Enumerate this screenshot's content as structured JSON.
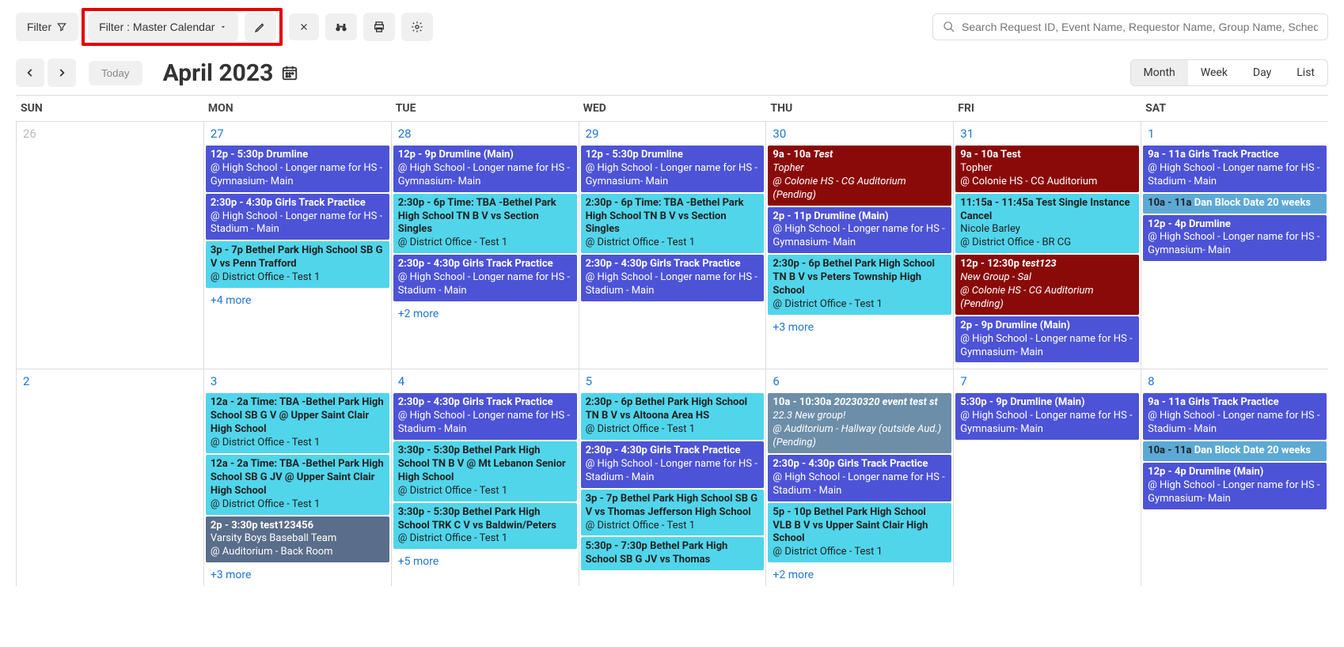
{
  "toolbar": {
    "filter_label": "Filter",
    "filter_master": "Filter : Master Calendar",
    "search_placeholder": "Search Request ID, Event Name, Requestor Name, Group Name, Schedule ID"
  },
  "header": {
    "today_label": "Today",
    "title": "April 2023",
    "views": [
      "Month",
      "Week",
      "Day",
      "List"
    ],
    "active_view": "Month"
  },
  "dayheaders": [
    "SUN",
    "MON",
    "TUE",
    "WED",
    "THU",
    "FRI",
    "SAT"
  ],
  "weeks": [
    {
      "days": [
        {
          "num": "26",
          "muted": true,
          "events": []
        },
        {
          "num": "27",
          "events": [
            {
              "cls": "indigo",
              "t": "12p - 5:30p Drumline",
              "d": "@ High School - Longer name for HS - Gymnasium- Main"
            },
            {
              "cls": "indigo",
              "t": "2:30p - 4:30p Girls Track Practice",
              "d": "@ High School - Longer name for HS - Stadium - Main"
            },
            {
              "cls": "cyan",
              "t": "3p - 7p Bethel Park High School SB G V vs Penn Trafford",
              "d": "@ District Office - Test 1"
            }
          ],
          "more": "+4 more"
        },
        {
          "num": "28",
          "events": [
            {
              "cls": "indigo",
              "t": "12p - 9p Drumline (Main)",
              "d": "@ High School - Longer name for HS - Gymnasium- Main"
            },
            {
              "cls": "cyan",
              "t": "2:30p - 6p Time: TBA -Bethel Park High School TN B V vs Section Singles",
              "d": "@ District Office - Test 1"
            },
            {
              "cls": "indigo",
              "t": "2:30p - 4:30p Girls Track Practice",
              "d": "@ High School - Longer name for HS - Stadium - Main"
            }
          ],
          "more": "+2 more"
        },
        {
          "num": "29",
          "events": [
            {
              "cls": "indigo",
              "t": "12p - 5:30p Drumline",
              "d": "@ High School - Longer name for HS - Gymnasium- Main"
            },
            {
              "cls": "cyan",
              "t": "2:30p - 6p Time: TBA -Bethel Park High School TN B V vs Section Singles",
              "d": "@ District Office - Test 1"
            },
            {
              "cls": "indigo",
              "t": "2:30p - 4:30p Girls Track Practice",
              "d": "@ High School - Longer name for HS - Stadium - Main"
            }
          ]
        },
        {
          "num": "30",
          "events": [
            {
              "cls": "maroon",
              "t": "9a - 10a <i>Test</i>",
              "d": "<i>Topher<br>@ Colonie HS - CG Auditorium (Pending)</i>"
            },
            {
              "cls": "indigo",
              "t": "2p - 11p Drumline (Main)",
              "d": "@ High School - Longer name for HS - Gymnasium- Main"
            },
            {
              "cls": "cyan",
              "t": "2:30p - 6p Bethel Park High School TN B V vs Peters Township High School",
              "d": "@ District Office - Test 1"
            }
          ],
          "more": "+3 more"
        },
        {
          "num": "31",
          "events": [
            {
              "cls": "maroon",
              "t": "9a - 10a Test",
              "d": "Topher<br>@ Colonie HS - CG Auditorium"
            },
            {
              "cls": "cyan",
              "t": "11:15a - 11:45a Test Single Instance Cancel",
              "d": "Nicole Barley<br>@ District Office - BR CG"
            },
            {
              "cls": "maroon",
              "t": "12p - 12:30p <i>test123</i>",
              "d": "<i>New Group - Sal<br>@ Colonie HS - CG Auditorium (Pending)</i>"
            },
            {
              "cls": "indigo",
              "t": "2p - 9p Drumline (Main)",
              "d": "@ High School - Longer name for HS - Gymnasium- Main"
            }
          ]
        },
        {
          "num": "1",
          "events": [
            {
              "cls": "indigo",
              "t": "9a - 11a Girls Track Practice",
              "d": "@ High School - Longer name for HS - Stadium - Main"
            },
            {
              "cls": "lightblue",
              "t": "10a - 11a <span style='color:#fff'>Dan Block Date 20 weeks</span>",
              "d": ""
            },
            {
              "cls": "indigo",
              "t": "12p - 4p Drumline",
              "d": "@ High School - Longer name for HS - Gymnasium- Main"
            }
          ]
        }
      ]
    },
    {
      "days": [
        {
          "num": "2",
          "events": []
        },
        {
          "num": "3",
          "events": [
            {
              "cls": "cyan",
              "t": "12a - 2a Time: TBA -Bethel Park High School SB G V @ Upper Saint Clair High School",
              "d": "@ District Office - Test 1"
            },
            {
              "cls": "cyan",
              "t": "12a - 2a Time: TBA -Bethel Park High School SB G JV @ Upper Saint Clair High School",
              "d": "@ District Office - Test 1"
            },
            {
              "cls": "slate",
              "t": "2p - 3:30p test123456",
              "d": "Varsity Boys Baseball Team<br>@ Auditorium - Back Room"
            }
          ],
          "more": "+3 more"
        },
        {
          "num": "4",
          "events": [
            {
              "cls": "indigo",
              "t": "2:30p - 4:30p Girls Track Practice",
              "d": "@ High School - Longer name for HS - Stadium - Main"
            },
            {
              "cls": "cyan",
              "t": "3:30p - 5:30p Bethel Park High School TN B V @ Mt Lebanon Senior High School",
              "d": "@ District Office - Test 1"
            },
            {
              "cls": "cyan",
              "t": "3:30p - 5:30p Bethel Park High School TRK C V vs Baldwin/Peters",
              "d": "@ District Office - Test 1"
            }
          ],
          "more": "+5 more"
        },
        {
          "num": "5",
          "events": [
            {
              "cls": "cyan",
              "t": "2:30p - 6p Bethel Park High School TN B V vs Altoona Area HS",
              "d": "@ District Office - Test 1"
            },
            {
              "cls": "indigo",
              "t": "2:30p - 4:30p Girls Track Practice",
              "d": "@ High School - Longer name for HS - Stadium - Main"
            },
            {
              "cls": "cyan",
              "t": "3p - 7p Bethel Park High School SB G V vs Thomas Jefferson High School",
              "d": "@ District Office - Test 1"
            },
            {
              "cls": "cyan",
              "t": "5:30p - 7:30p Bethel Park High School SB G JV vs Thomas",
              "d": ""
            }
          ]
        },
        {
          "num": "6",
          "events": [
            {
              "cls": "grayblue",
              "t": "10a - 10:30a <i>20230320 event test st</i>",
              "d": "<i>22.3 New group!<br>@ Auditorium - Hallway (outside Aud.) (Pending)</i>"
            },
            {
              "cls": "indigo",
              "t": "2:30p - 4:30p Girls Track Practice",
              "d": "@ High School - Longer name for HS - Stadium - Main"
            },
            {
              "cls": "cyan",
              "t": "5p - 10p Bethel Park High School VLB B V vs Upper Saint Clair High School",
              "d": "@ District Office - Test 1"
            }
          ],
          "more": "+2 more"
        },
        {
          "num": "7",
          "events": [
            {
              "cls": "indigo",
              "t": "5:30p - 9p Drumline (Main)",
              "d": "@ High School - Longer name for HS - Gymnasium- Main"
            }
          ]
        },
        {
          "num": "8",
          "events": [
            {
              "cls": "indigo",
              "t": "9a - 11a Girls Track Practice",
              "d": "@ High School - Longer name for HS - Stadium - Main"
            },
            {
              "cls": "lightblue",
              "t": "10a - 11a <span style='color:#fff'>Dan Block Date 20 weeks</span>",
              "d": ""
            },
            {
              "cls": "indigo",
              "t": "12p - 4p Drumline (Main)",
              "d": "@ High School - Longer name for HS - Gymnasium- Main"
            }
          ]
        }
      ]
    }
  ]
}
